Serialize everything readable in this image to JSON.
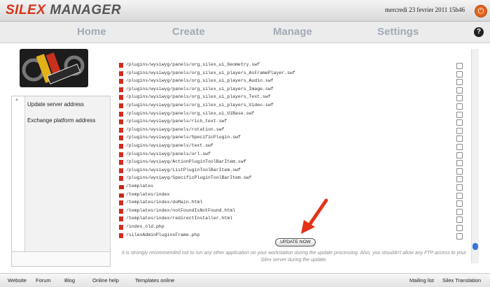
{
  "app": {
    "logo_part1": "SILEX",
    "logo_part2": "MANAGER",
    "date": "mercredi 23 fevrier 2011 15h46"
  },
  "nav": {
    "home": "Home",
    "create": "Create",
    "manage": "Manage",
    "settings": "Settings",
    "help": "?"
  },
  "sidebar": {
    "items": [
      {
        "label": "Update server address"
      },
      {
        "label": "Exchange platform address"
      }
    ]
  },
  "files": [
    {
      "path": "/plugins/wysiwyg/panels/org_silex_ui_Geometry.swf",
      "type": "file"
    },
    {
      "path": "/plugins/wysiwyg/panels/org_silex_ui_players_AsFramePlayer.swf",
      "type": "file"
    },
    {
      "path": "/plugins/wysiwyg/panels/org_silex_ui_players_Audio.swf",
      "type": "file"
    },
    {
      "path": "/plugins/wysiwyg/panels/org_silex_ui_players_Image.swf",
      "type": "file"
    },
    {
      "path": "/plugins/wysiwyg/panels/org_silex_ui_players_Text.swf",
      "type": "file"
    },
    {
      "path": "/plugins/wysiwyg/panels/org_silex_ui_players_Video.swf",
      "type": "file"
    },
    {
      "path": "/plugins/wysiwyg/panels/org_silex_ui_UiBase.swf",
      "type": "file"
    },
    {
      "path": "/plugins/wysiwyg/panels/rich_text.swf",
      "type": "file"
    },
    {
      "path": "/plugins/wysiwyg/panels/rotation.swf",
      "type": "file"
    },
    {
      "path": "/plugins/wysiwyg/panels/SpecificPlugin.swf",
      "type": "file"
    },
    {
      "path": "/plugins/wysiwyg/panels/text.swf",
      "type": "file"
    },
    {
      "path": "/plugins/wysiwyg/panels/url.swf",
      "type": "file"
    },
    {
      "path": "/plugins/wysiwyg/ActionPluginToolBarItem.swf",
      "type": "file"
    },
    {
      "path": "/plugins/wysiwyg/ListPluginToolBarItem.swf",
      "type": "file"
    },
    {
      "path": "/plugins/wysiwyg/SpecificPluginToolBarItem.swf",
      "type": "file"
    },
    {
      "path": "/templates",
      "type": "folder"
    },
    {
      "path": "/templates/index",
      "type": "folder"
    },
    {
      "path": "/templates/index/doMain.html",
      "type": "file"
    },
    {
      "path": "/templates/index/notFoundIsNotFound.html",
      "type": "file"
    },
    {
      "path": "/templates/index/redirectInstaller.html",
      "type": "file"
    },
    {
      "path": "/index_old.php",
      "type": "file"
    },
    {
      "path": "/silexAdminPluginsFrame.php",
      "type": "file"
    }
  ],
  "update_button": "UPDATE NOW",
  "warning": "It is strongly recommended not to run any other application on your workstation during the update processing. Also, you shouldn't allow any FTP access to your Silex server during the update.",
  "footer": {
    "website": "Website",
    "forum": "Forum",
    "blog": "Blog",
    "online_help": "Online help",
    "templates_online": "Templates online",
    "mailing_list": "Mailing list",
    "translation": "Silex Translation"
  },
  "colors": {
    "logo_red": "#d8321b",
    "nav_text": "#a2aab6",
    "file_icon": "#d32b1e",
    "scroll_thumb": "#3b73d6",
    "arrow": "#e23317"
  }
}
